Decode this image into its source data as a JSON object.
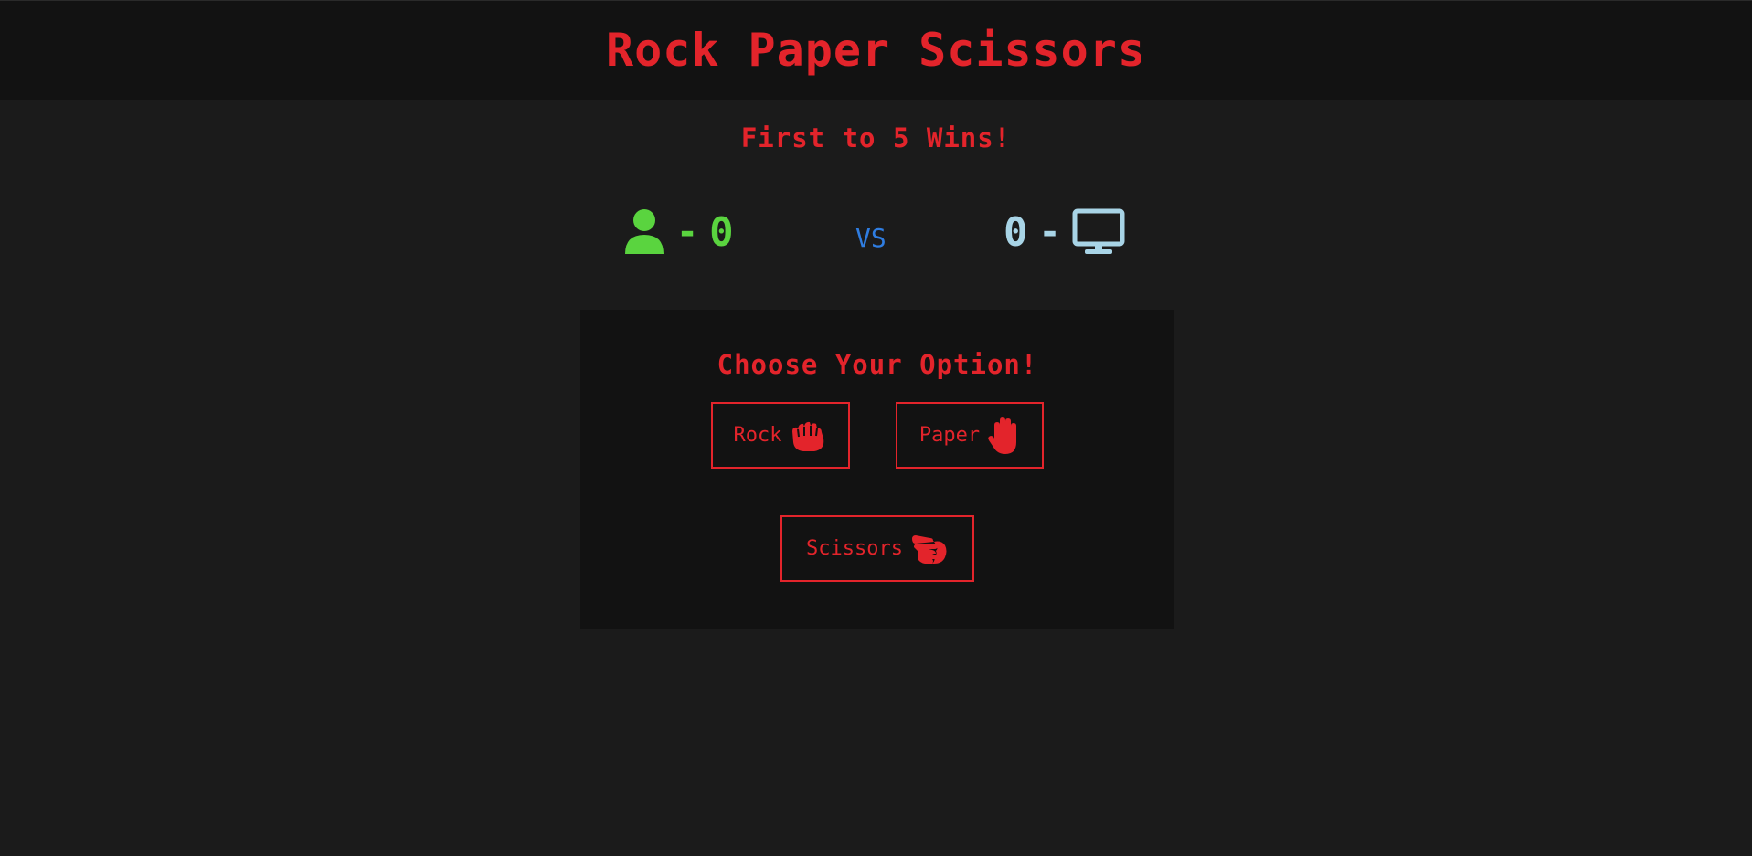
{
  "header": {
    "title": "Rock Paper Scissors"
  },
  "subtitle": "First to 5 Wins!",
  "scoreboard": {
    "player": {
      "icon": "user-icon",
      "dash": "-",
      "score": "0",
      "color": "#5ad43f"
    },
    "vs": "VS",
    "computer": {
      "icon": "desktop-icon",
      "dash": "-",
      "score": "0",
      "color": "#a8d4e6"
    }
  },
  "panel": {
    "title": "Choose Your Option!",
    "options": [
      {
        "label": "Rock",
        "icon": "hand-rock-icon"
      },
      {
        "label": "Paper",
        "icon": "hand-paper-icon"
      },
      {
        "label": "Scissors",
        "icon": "hand-scissors-icon"
      }
    ]
  },
  "colors": {
    "accent": "#e3242b",
    "background": "#1b1b1b",
    "panel": "#121212",
    "vs": "#2f7de1"
  }
}
